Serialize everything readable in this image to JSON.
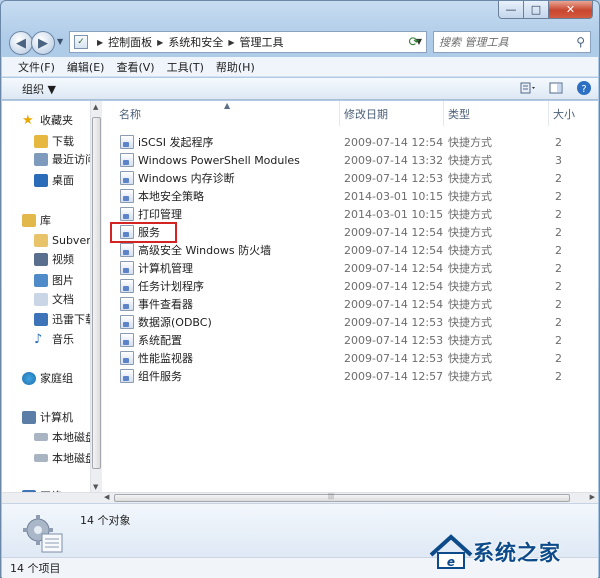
{
  "window": {
    "caption": {
      "minimize": "—",
      "maximize": "□",
      "close": "✕"
    }
  },
  "address": {
    "crumbs": [
      "控制面板",
      "系统和安全",
      "管理工具"
    ]
  },
  "search": {
    "placeholder": "搜索 管理工具"
  },
  "menu": [
    "文件(F)",
    "编辑(E)",
    "查看(V)",
    "工具(T)",
    "帮助(H)"
  ],
  "toolbar": {
    "organize": "组织 ▼"
  },
  "nav": {
    "items": [
      {
        "label": "收藏夹",
        "icon": "star-icon"
      },
      {
        "label": "下载",
        "icon": "downloads-icon"
      },
      {
        "label": "最近访问",
        "icon": "recent-icon"
      },
      {
        "label": "桌面",
        "icon": "desktop-icon"
      },
      {
        "label": "库",
        "icon": "library-icon"
      },
      {
        "label": "Subvers",
        "icon": "folder-icon"
      },
      {
        "label": "视频",
        "icon": "video-icon"
      },
      {
        "label": "图片",
        "icon": "pictures-icon"
      },
      {
        "label": "文档",
        "icon": "documents-icon"
      },
      {
        "label": "迅雷下载",
        "icon": "thunder-icon"
      },
      {
        "label": "音乐",
        "icon": "music-icon"
      },
      {
        "label": "家庭组",
        "icon": "homegroup-icon"
      },
      {
        "label": "计算机",
        "icon": "computer-icon"
      },
      {
        "label": "本地磁盘",
        "icon": "drive-icon"
      },
      {
        "label": "本地磁盘",
        "icon": "drive-icon"
      },
      {
        "label": "网络",
        "icon": "network-icon"
      }
    ]
  },
  "columns": {
    "name": "名称",
    "date": "修改日期",
    "type": "类型",
    "size": "大小"
  },
  "files": [
    {
      "name": "iSCSI 发起程序",
      "date": "2009-07-14 12:54",
      "type": "快捷方式",
      "size": "2"
    },
    {
      "name": "Windows PowerShell Modules",
      "date": "2009-07-14 13:32",
      "type": "快捷方式",
      "size": "3"
    },
    {
      "name": "Windows 内存诊断",
      "date": "2009-07-14 12:53",
      "type": "快捷方式",
      "size": "2"
    },
    {
      "name": "本地安全策略",
      "date": "2014-03-01 10:15",
      "type": "快捷方式",
      "size": "2"
    },
    {
      "name": "打印管理",
      "date": "2014-03-01 10:15",
      "type": "快捷方式",
      "size": "2"
    },
    {
      "name": "服务",
      "date": "2009-07-14 12:54",
      "type": "快捷方式",
      "size": "2"
    },
    {
      "name": "高级安全 Windows 防火墙",
      "date": "2009-07-14 12:54",
      "type": "快捷方式",
      "size": "2"
    },
    {
      "name": "计算机管理",
      "date": "2009-07-14 12:54",
      "type": "快捷方式",
      "size": "2"
    },
    {
      "name": "任务计划程序",
      "date": "2009-07-14 12:54",
      "type": "快捷方式",
      "size": "2"
    },
    {
      "name": "事件查看器",
      "date": "2009-07-14 12:54",
      "type": "快捷方式",
      "size": "2"
    },
    {
      "name": "数据源(ODBC)",
      "date": "2009-07-14 12:53",
      "type": "快捷方式",
      "size": "2"
    },
    {
      "name": "系统配置",
      "date": "2009-07-14 12:53",
      "type": "快捷方式",
      "size": "2"
    },
    {
      "name": "性能监视器",
      "date": "2009-07-14 12:53",
      "type": "快捷方式",
      "size": "2"
    },
    {
      "name": "组件服务",
      "date": "2009-07-14 12:57",
      "type": "快捷方式",
      "size": "2"
    }
  ],
  "details": {
    "count": "14 个对象"
  },
  "status": {
    "items": "14 个项目"
  },
  "watermark": {
    "text": "系统之家"
  },
  "colors": {
    "highlight": "#d32323",
    "accent": "#0c4a8a"
  }
}
